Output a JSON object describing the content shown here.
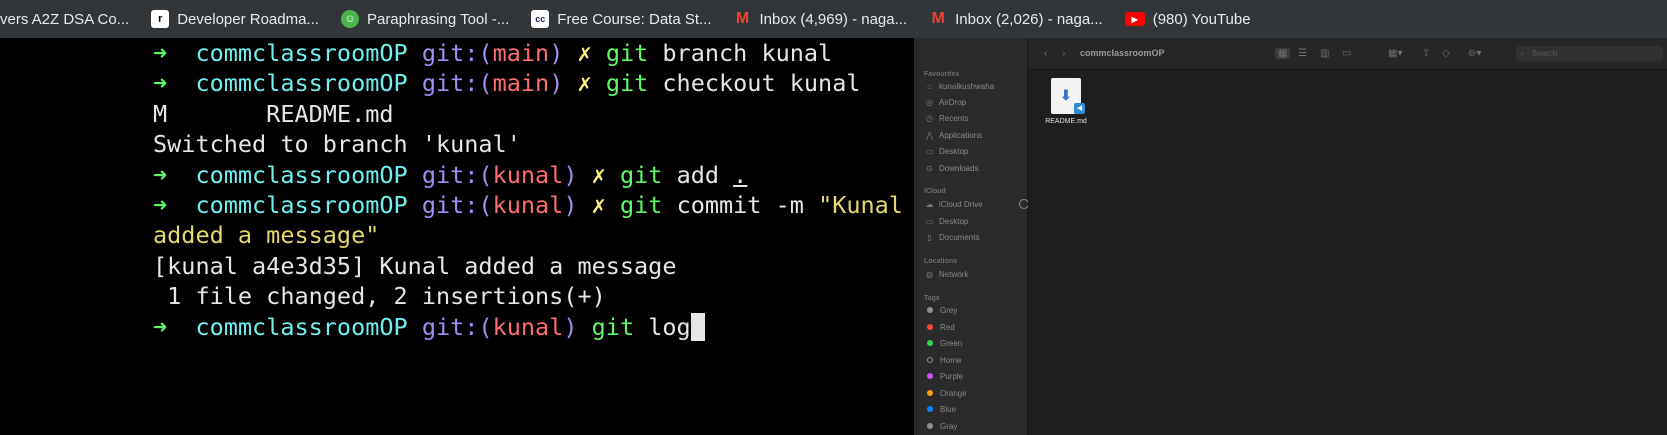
{
  "bookmarks": [
    {
      "label": "vers A2Z DSA Co...",
      "icon": "none"
    },
    {
      "label": "Developer Roadma...",
      "icon": "roadmap-icon",
      "bg": "#ffffff",
      "fg": "#000000",
      "glyph": "r"
    },
    {
      "label": "Paraphrasing Tool -...",
      "icon": "quillbot-icon",
      "bg": "#4bb54b",
      "fg": "#ffffff",
      "glyph": "☺"
    },
    {
      "label": "Free Course: Data St...",
      "icon": "cc-icon",
      "bg": "#ffffff",
      "fg": "#1a1a5e",
      "glyph": "cc"
    },
    {
      "label": "Inbox (4,969) - naga...",
      "icon": "gmail-icon",
      "bg": "transparent",
      "fg": "#ea4335",
      "glyph": "M"
    },
    {
      "label": "Inbox (2,026) - naga...",
      "icon": "gmail-icon",
      "bg": "transparent",
      "fg": "#ea4335",
      "glyph": "M"
    },
    {
      "label": "(980) YouTube",
      "icon": "youtube-icon",
      "bg": "#ff0000",
      "fg": "#ffffff",
      "glyph": "▶"
    }
  ],
  "terminal": {
    "arrow": "➜",
    "dir": "commclassroomOP",
    "git_open": "git:(",
    "git_close": ")",
    "x": "✗",
    "line1": {
      "branch": "main",
      "cmd": "git",
      "args": " branch kunal"
    },
    "line2": {
      "branch": "main",
      "cmd": "git",
      "args": " checkout kunal"
    },
    "line3": "M       README.md",
    "line4": "Switched to branch 'kunal'",
    "line5": {
      "branch": "kunal",
      "cmd": "git",
      "args": " add ",
      "dot": "."
    },
    "line6": {
      "branch": "kunal",
      "cmd": "git",
      "args": " commit -m ",
      "str": "\"Kunal"
    },
    "line7": "added a message\"",
    "line8": "[kunal a4e3d35] Kunal added a message",
    "line9": " 1 file changed, 2 insertions(+)",
    "line10": {
      "branch": "kunal",
      "cmd": "git",
      "args": " log"
    }
  },
  "finder": {
    "title": "commclassroomOP",
    "search_placeholder": "Search",
    "sections": {
      "favourites": "Favourites",
      "icloud": "iCloud",
      "locations": "Locations",
      "tags": "Tags"
    },
    "favourites": [
      "kunalkushwaha",
      "AirDrop",
      "Recents",
      "Applications",
      "Desktop",
      "Downloads"
    ],
    "icloud": [
      "iCloud Drive",
      "Desktop",
      "Documents"
    ],
    "locations": [
      "Network"
    ],
    "tags": [
      {
        "label": "Grey",
        "color": "#8e8e93"
      },
      {
        "label": "Red",
        "color": "#ff453a"
      },
      {
        "label": "Green",
        "color": "#32d74b"
      },
      {
        "label": "Home",
        "color": "transparent"
      },
      {
        "label": "Purple",
        "color": "#bf5af2"
      },
      {
        "label": "Orange",
        "color": "#ff9f0a"
      },
      {
        "label": "Blue",
        "color": "#0a84ff"
      },
      {
        "label": "Gray",
        "color": "#8e8e93"
      }
    ],
    "file_name": "README.md"
  }
}
